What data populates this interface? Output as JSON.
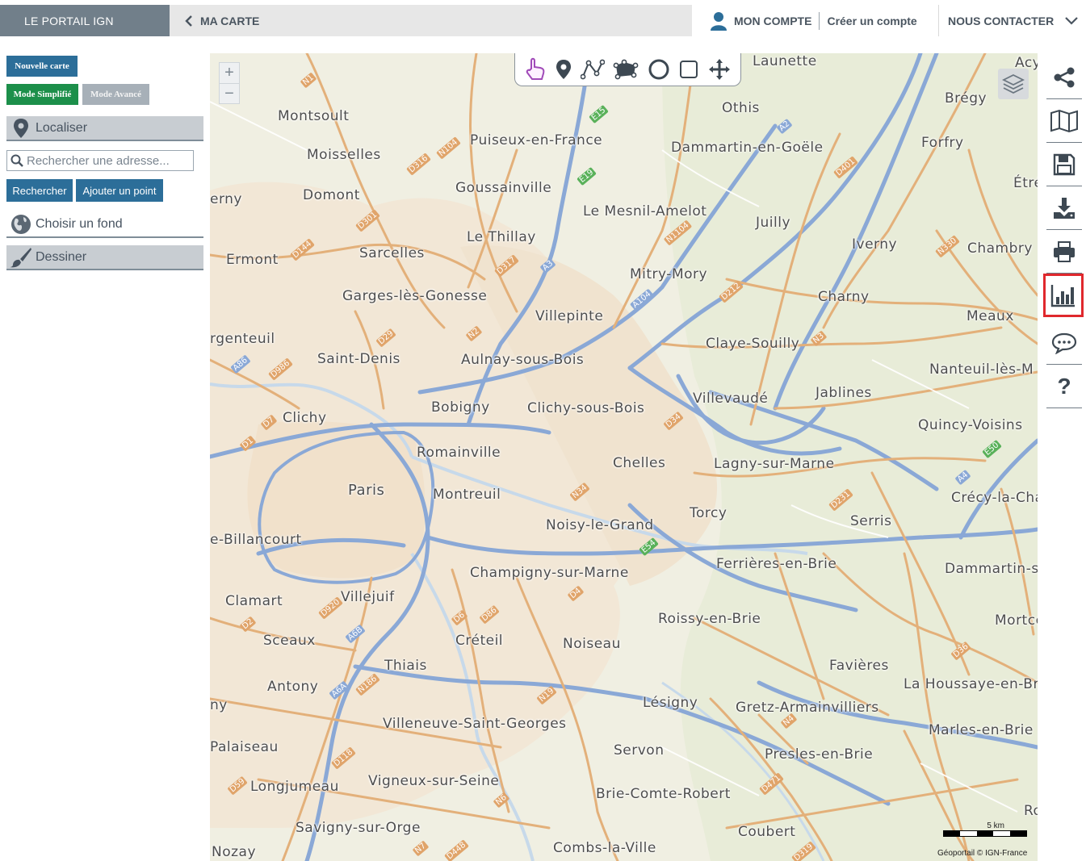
{
  "header": {
    "brand": "LE PORTAIL IGN",
    "breadcrumb": "MA CARTE",
    "my_account": "MON COMPTE",
    "create_account": "Créer un compte",
    "contact": "NOUS CONTACTER"
  },
  "panel": {
    "new_map": "Nouvelle carte",
    "mode_simple": "Mode Simplifié",
    "mode_advanced": "Mode Avancé",
    "locate": "Localiser",
    "search_placeholder": "Rechercher une adresse...",
    "search_button": "Rechercher",
    "add_point_button": "Ajouter un point",
    "choose_background": "Choisir un fond",
    "draw": "Dessiner"
  },
  "map": {
    "zoom_in": "+",
    "zoom_out": "−",
    "scale_label": "5 km",
    "credit": "Géoportail © IGN-France",
    "places": [
      {
        "name": "Launette"
      },
      {
        "name": "Acy"
      },
      {
        "name": "Othis"
      },
      {
        "name": "Brégy"
      },
      {
        "name": "Montsoult"
      },
      {
        "name": "Puiseux-en-France"
      },
      {
        "name": "Dammartin-en-Goële"
      },
      {
        "name": "Forfry"
      },
      {
        "name": "Moisselles"
      },
      {
        "name": "Goussainville"
      },
      {
        "name": "Étré"
      },
      {
        "name": "Domont"
      },
      {
        "name": "erny"
      },
      {
        "name": "Le Mesnil-Amelot"
      },
      {
        "name": "Juilly"
      },
      {
        "name": "Le Thillay"
      },
      {
        "name": "Iverny"
      },
      {
        "name": "Chambry"
      },
      {
        "name": "Sarcelles"
      },
      {
        "name": "Ermont"
      },
      {
        "name": "Mitry-Mory"
      },
      {
        "name": "Garges-lès-Gonesse"
      },
      {
        "name": "Charny"
      },
      {
        "name": "Villepinte"
      },
      {
        "name": "Meaux"
      },
      {
        "name": "rgenteuil"
      },
      {
        "name": "Claye-Souilly"
      },
      {
        "name": "Saint-Denis"
      },
      {
        "name": "Aulnay-sous-Bois"
      },
      {
        "name": "Nanteuil-lès-M"
      },
      {
        "name": "Jablines"
      },
      {
        "name": "Villevaudé"
      },
      {
        "name": "Bobigny"
      },
      {
        "name": "Clichy-sous-Bois"
      },
      {
        "name": "Clichy"
      },
      {
        "name": "Quincy-Voisins"
      },
      {
        "name": "Romainville"
      },
      {
        "name": "Chelles"
      },
      {
        "name": "Lagny-sur-Marne"
      },
      {
        "name": "Paris"
      },
      {
        "name": "Montreuil"
      },
      {
        "name": "Crécy-la-Cha"
      },
      {
        "name": "Torcy"
      },
      {
        "name": "Serris"
      },
      {
        "name": "Noisy-le-Grand"
      },
      {
        "name": "e-Billancourt"
      },
      {
        "name": "Ferrières-en-Brie"
      },
      {
        "name": "Dammartin-su"
      },
      {
        "name": "Champigny-sur-Marne"
      },
      {
        "name": "Clamart"
      },
      {
        "name": "Villejuif"
      },
      {
        "name": "Roissy-en-Brie"
      },
      {
        "name": "Mortce"
      },
      {
        "name": "Sceaux"
      },
      {
        "name": "Créteil"
      },
      {
        "name": "Noiseau"
      },
      {
        "name": "Thiais"
      },
      {
        "name": "Favières"
      },
      {
        "name": "Antony"
      },
      {
        "name": "La Houssaye-en-Bri"
      },
      {
        "name": "Lésigny"
      },
      {
        "name": "ny"
      },
      {
        "name": "Gretz-Armainvilliers"
      },
      {
        "name": "Villeneuve-Saint-Georges"
      },
      {
        "name": "Marles-en-Brie"
      },
      {
        "name": "Palaiseau"
      },
      {
        "name": "Servon"
      },
      {
        "name": "Presles-en-Brie"
      },
      {
        "name": "Longjumeau"
      },
      {
        "name": "Vigneux-sur-Seine"
      },
      {
        "name": "Brie-Comte-Robert"
      },
      {
        "name": "Ro"
      },
      {
        "name": "Savigny-sur-Orge"
      },
      {
        "name": "Coubert"
      },
      {
        "name": "Nozay"
      },
      {
        "name": "Combs-la-Ville"
      }
    ],
    "road_labels": [
      "N1",
      "N104",
      "D316",
      "E15",
      "E19",
      "A2",
      "D401",
      "N1104",
      "D301",
      "D144",
      "D317",
      "A3",
      "D212",
      "N330",
      "A104",
      "D29",
      "N2",
      "N3",
      "A86",
      "D986",
      "D7",
      "D1",
      "D34",
      "E50",
      "A4",
      "N34",
      "D231",
      "E54",
      "D920",
      "D2",
      "A6B",
      "D4",
      "D86",
      "D6",
      "N186",
      "A6A",
      "N19",
      "D36",
      "N4",
      "D118",
      "D59",
      "D471",
      "N6",
      "N7",
      "D448",
      "D319"
    ]
  },
  "toolbar": {
    "tools": [
      "share-icon",
      "map-icon",
      "save-icon",
      "download-icon",
      "print-icon",
      "chart-icon",
      "comment-icon",
      "help-icon"
    ],
    "help_label": "?",
    "active_tool": "chart-icon",
    "active_color": "#e0282d"
  }
}
